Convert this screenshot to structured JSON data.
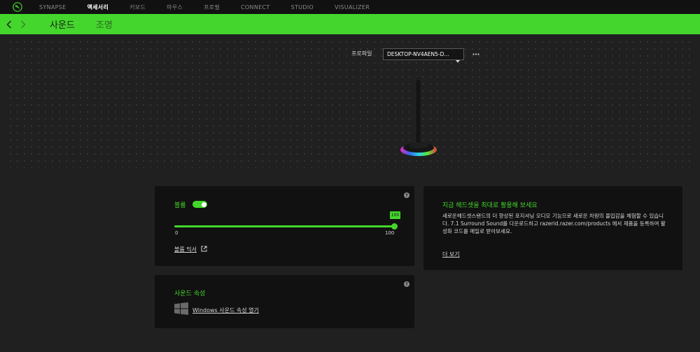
{
  "nav": {
    "tabs": [
      {
        "label": "SYNAPSE"
      },
      {
        "label": "액세서리"
      },
      {
        "label": "키보드"
      },
      {
        "label": "마우스"
      },
      {
        "label": "프로필"
      },
      {
        "label": "CONNECT"
      },
      {
        "label": "STUDIO"
      },
      {
        "label": "VISUALIZER"
      }
    ],
    "active_index": 1
  },
  "subnav": {
    "tabs": [
      {
        "label": "사운드"
      },
      {
        "label": "조명"
      }
    ],
    "active_index": 0
  },
  "profile": {
    "label": "프로파일",
    "selected": "DESKTOP-NV4AEN5-D...",
    "more_icon": "ellipsis-icon"
  },
  "volume_card": {
    "label": "볼륨",
    "toggle_on": true,
    "value": 100,
    "bubble": "100",
    "min": "0",
    "max": "100",
    "mixer_link": "볼륨 믹서"
  },
  "sound_props_card": {
    "title": "사운드 속성",
    "windows_link": "Windows 사운드 속성 열기"
  },
  "promo_card": {
    "title": "지금 헤드셋을 최대로 활용해 보세요",
    "body": "새로운헤드셋스탠드의 더 향상된 포지셔닝 오디오 기능으로 새로운 차원의 몰입감을 체험할 수 있습니다. 7.1 Surround Sound를 다운로드하고 razerid.razer.com/products 에서 제품을 등록하여 활성화 코드를 메일로 받아보세요.",
    "link": "더 보기"
  },
  "colors": {
    "accent": "#44d62c",
    "background": "#202020",
    "card": "#111111"
  }
}
